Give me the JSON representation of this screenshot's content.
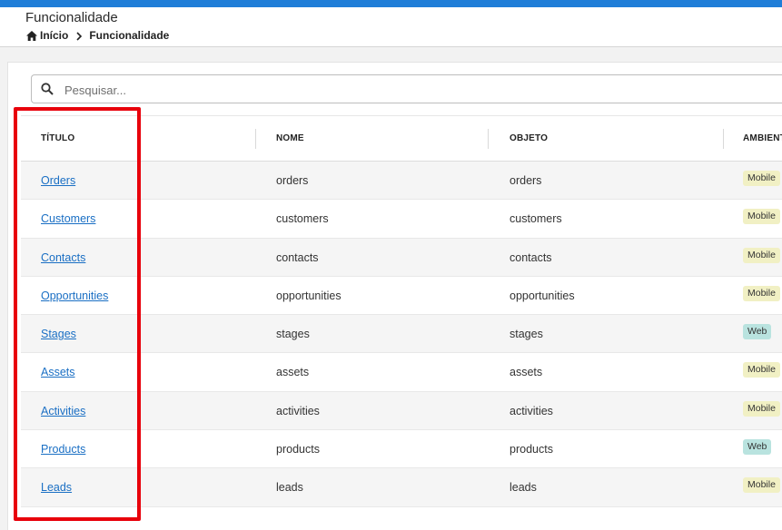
{
  "header": {
    "title": "Funcionalidade",
    "breadcrumb": {
      "home": "Início",
      "current": "Funcionalidade"
    }
  },
  "search": {
    "placeholder": "Pesquisar...",
    "value": ""
  },
  "table": {
    "columns": [
      "TÍTULO",
      "NOME",
      "OBJETO",
      "AMBIENT"
    ],
    "rows": [
      {
        "titulo": "Orders",
        "nome": "orders",
        "objeto": "orders",
        "ambiente": "Mobile"
      },
      {
        "titulo": "Customers",
        "nome": "customers",
        "objeto": "customers",
        "ambiente": "Mobile"
      },
      {
        "titulo": "Contacts",
        "nome": "contacts",
        "objeto": "contacts",
        "ambiente": "Mobile"
      },
      {
        "titulo": "Opportunities",
        "nome": "opportunities",
        "objeto": "opportunities",
        "ambiente": "Mobile"
      },
      {
        "titulo": "Stages",
        "nome": "stages",
        "objeto": "stages",
        "ambiente": "Web"
      },
      {
        "titulo": "Assets",
        "nome": "assets",
        "objeto": "assets",
        "ambiente": "Mobile"
      },
      {
        "titulo": "Activities",
        "nome": "activities",
        "objeto": "activities",
        "ambiente": "Mobile"
      },
      {
        "titulo": "Products",
        "nome": "products",
        "objeto": "products",
        "ambiente": "Web"
      },
      {
        "titulo": "Leads",
        "nome": "leads",
        "objeto": "leads",
        "ambiente": "Mobile"
      }
    ]
  },
  "colors": {
    "accent": "#1f7ed8",
    "link": "#1a6fc4",
    "highlight": "#e8000b",
    "badge_mobile": "#f1f0c4",
    "badge_web": "#b9e3df"
  },
  "icons": {
    "home": "home-icon",
    "breadcrumb_separator": "chevron-right-icon",
    "search": "search-icon"
  }
}
